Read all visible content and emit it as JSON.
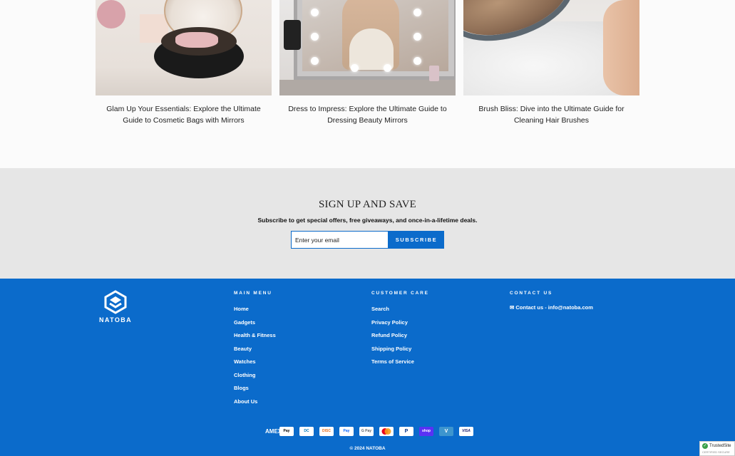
{
  "articles": [
    {
      "title": "Glam Up Your Essentials: Explore the Ultimate Guide to Cosmetic Bags with Mirrors",
      "image": "cosmetic-bag-photo"
    },
    {
      "title": "Dress to Impress: Explore the Ultimate Guide to Dressing Beauty Mirrors",
      "image": "vanity-mirror-photo"
    },
    {
      "title": "Brush Bliss: Dive into the Ultimate Guide for Cleaning Hair Brushes",
      "image": "hair-brush-photo"
    }
  ],
  "signup": {
    "heading": "SIGN UP AND SAVE",
    "subtitle": "Subscribe to get special offers, free giveaways, and once-in-a-lifetime deals.",
    "email_placeholder": "Enter your email",
    "button_label": "SUBSCRIBE"
  },
  "footer": {
    "brand": "NATOBA",
    "main_menu": {
      "heading": "MAIN MENU",
      "items": [
        "Home",
        "Gadgets",
        "Health & Fitness",
        "Beauty",
        "Watches",
        "Clothing",
        "Blogs",
        "About Us"
      ]
    },
    "customer_care": {
      "heading": "CUSTOMER CARE",
      "items": [
        "Search",
        "Privacy Policy",
        "Refund Policy",
        "Shipping Policy",
        "Terms of Service"
      ]
    },
    "contact": {
      "heading": "CONTACT US",
      "text": "✉ Contact us - info@natoba.com"
    },
    "payments": [
      {
        "name": "American Express",
        "label": "AMEX"
      },
      {
        "name": "Apple Pay",
        "label": "Pay"
      },
      {
        "name": "Diners Club",
        "label": "DC"
      },
      {
        "name": "Discover",
        "label": "DISC"
      },
      {
        "name": "Meta Pay",
        "label": "Pay"
      },
      {
        "name": "Google Pay",
        "label": "G Pay"
      },
      {
        "name": "Mastercard",
        "label": ""
      },
      {
        "name": "PayPal",
        "label": "P"
      },
      {
        "name": "Shop Pay",
        "label": "shop"
      },
      {
        "name": "Venmo",
        "label": "V"
      },
      {
        "name": "Visa",
        "label": "VISA"
      }
    ],
    "copyright": "© 2024 NATOBA"
  },
  "trusted_badge": {
    "label": "TrustedSite",
    "sub": "CERTIFIED SECURE"
  },
  "colors": {
    "brand_blue": "#0b6bcb",
    "signup_bg": "#e6e6e6"
  }
}
